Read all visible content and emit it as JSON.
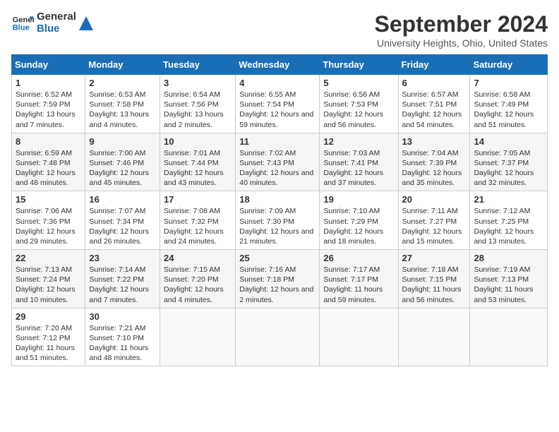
{
  "logo": {
    "line1": "General",
    "line2": "Blue"
  },
  "title": "September 2024",
  "subtitle": "University Heights, Ohio, United States",
  "days_of_week": [
    "Sunday",
    "Monday",
    "Tuesday",
    "Wednesday",
    "Thursday",
    "Friday",
    "Saturday"
  ],
  "weeks": [
    [
      {
        "day": "1",
        "sunrise": "6:52 AM",
        "sunset": "7:59 PM",
        "daylight": "13 hours and 7 minutes."
      },
      {
        "day": "2",
        "sunrise": "6:53 AM",
        "sunset": "7:58 PM",
        "daylight": "13 hours and 4 minutes."
      },
      {
        "day": "3",
        "sunrise": "6:54 AM",
        "sunset": "7:56 PM",
        "daylight": "13 hours and 2 minutes."
      },
      {
        "day": "4",
        "sunrise": "6:55 AM",
        "sunset": "7:54 PM",
        "daylight": "12 hours and 59 minutes."
      },
      {
        "day": "5",
        "sunrise": "6:56 AM",
        "sunset": "7:53 PM",
        "daylight": "12 hours and 56 minutes."
      },
      {
        "day": "6",
        "sunrise": "6:57 AM",
        "sunset": "7:51 PM",
        "daylight": "12 hours and 54 minutes."
      },
      {
        "day": "7",
        "sunrise": "6:58 AM",
        "sunset": "7:49 PM",
        "daylight": "12 hours and 51 minutes."
      }
    ],
    [
      {
        "day": "8",
        "sunrise": "6:59 AM",
        "sunset": "7:48 PM",
        "daylight": "12 hours and 48 minutes."
      },
      {
        "day": "9",
        "sunrise": "7:00 AM",
        "sunset": "7:46 PM",
        "daylight": "12 hours and 45 minutes."
      },
      {
        "day": "10",
        "sunrise": "7:01 AM",
        "sunset": "7:44 PM",
        "daylight": "12 hours and 43 minutes."
      },
      {
        "day": "11",
        "sunrise": "7:02 AM",
        "sunset": "7:43 PM",
        "daylight": "12 hours and 40 minutes."
      },
      {
        "day": "12",
        "sunrise": "7:03 AM",
        "sunset": "7:41 PM",
        "daylight": "12 hours and 37 minutes."
      },
      {
        "day": "13",
        "sunrise": "7:04 AM",
        "sunset": "7:39 PM",
        "daylight": "12 hours and 35 minutes."
      },
      {
        "day": "14",
        "sunrise": "7:05 AM",
        "sunset": "7:37 PM",
        "daylight": "12 hours and 32 minutes."
      }
    ],
    [
      {
        "day": "15",
        "sunrise": "7:06 AM",
        "sunset": "7:36 PM",
        "daylight": "12 hours and 29 minutes."
      },
      {
        "day": "16",
        "sunrise": "7:07 AM",
        "sunset": "7:34 PM",
        "daylight": "12 hours and 26 minutes."
      },
      {
        "day": "17",
        "sunrise": "7:08 AM",
        "sunset": "7:32 PM",
        "daylight": "12 hours and 24 minutes."
      },
      {
        "day": "18",
        "sunrise": "7:09 AM",
        "sunset": "7:30 PM",
        "daylight": "12 hours and 21 minutes."
      },
      {
        "day": "19",
        "sunrise": "7:10 AM",
        "sunset": "7:29 PM",
        "daylight": "12 hours and 18 minutes."
      },
      {
        "day": "20",
        "sunrise": "7:11 AM",
        "sunset": "7:27 PM",
        "daylight": "12 hours and 15 minutes."
      },
      {
        "day": "21",
        "sunrise": "7:12 AM",
        "sunset": "7:25 PM",
        "daylight": "12 hours and 13 minutes."
      }
    ],
    [
      {
        "day": "22",
        "sunrise": "7:13 AM",
        "sunset": "7:24 PM",
        "daylight": "12 hours and 10 minutes."
      },
      {
        "day": "23",
        "sunrise": "7:14 AM",
        "sunset": "7:22 PM",
        "daylight": "12 hours and 7 minutes."
      },
      {
        "day": "24",
        "sunrise": "7:15 AM",
        "sunset": "7:20 PM",
        "daylight": "12 hours and 4 minutes."
      },
      {
        "day": "25",
        "sunrise": "7:16 AM",
        "sunset": "7:18 PM",
        "daylight": "12 hours and 2 minutes."
      },
      {
        "day": "26",
        "sunrise": "7:17 AM",
        "sunset": "7:17 PM",
        "daylight": "11 hours and 59 minutes."
      },
      {
        "day": "27",
        "sunrise": "7:18 AM",
        "sunset": "7:15 PM",
        "daylight": "11 hours and 56 minutes."
      },
      {
        "day": "28",
        "sunrise": "7:19 AM",
        "sunset": "7:13 PM",
        "daylight": "11 hours and 53 minutes."
      }
    ],
    [
      {
        "day": "29",
        "sunrise": "7:20 AM",
        "sunset": "7:12 PM",
        "daylight": "11 hours and 51 minutes."
      },
      {
        "day": "30",
        "sunrise": "7:21 AM",
        "sunset": "7:10 PM",
        "daylight": "11 hours and 48 minutes."
      },
      null,
      null,
      null,
      null,
      null
    ]
  ]
}
